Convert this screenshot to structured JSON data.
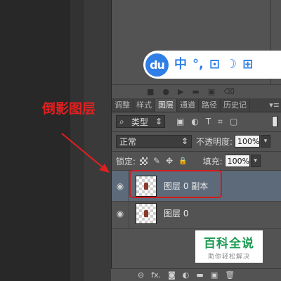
{
  "ime": {
    "logo": "du",
    "items": [
      {
        "icon": "chinese-mode-icon",
        "text": "中"
      },
      {
        "icon": "punctuation-icon",
        "text": "°,"
      },
      {
        "icon": "keyboard-icon",
        "text": "⊡"
      },
      {
        "icon": "skin-moon-icon",
        "text": "☽"
      },
      {
        "icon": "grid-menu-icon",
        "text": "⊞"
      }
    ]
  },
  "mini_bar": {
    "icons": [
      "■",
      "●",
      "▶",
      "▬",
      "▣",
      "⌫"
    ]
  },
  "tabs": [
    {
      "label": "调整",
      "active": false
    },
    {
      "label": "样式",
      "active": false
    },
    {
      "label": "图层",
      "active": true
    },
    {
      "label": "通道",
      "active": false
    },
    {
      "label": "路径",
      "active": false
    },
    {
      "label": "历史记",
      "active": false
    }
  ],
  "tab_menu": "▾≡",
  "filter": {
    "search_icon": "⌕",
    "label": "类型",
    "arrow": "⇕",
    "icons": [
      {
        "name": "pixel-filter-icon",
        "glyph": "▣"
      },
      {
        "name": "adjustment-filter-icon",
        "glyph": "◐"
      },
      {
        "name": "type-filter-icon",
        "glyph": "T"
      },
      {
        "name": "shape-filter-icon",
        "glyph": "⌗"
      },
      {
        "name": "smart-object-filter-icon",
        "glyph": "▢"
      }
    ]
  },
  "blend": {
    "mode": "正常",
    "arrow": "⇕",
    "opacity_label": "不透明度:",
    "opacity_value": "100%",
    "dropdown_arrow": "▾"
  },
  "lock": {
    "label": "锁定:",
    "icons": [
      {
        "name": "brush-icon",
        "glyph": "✎"
      },
      {
        "name": "move-icon",
        "glyph": "✥"
      },
      {
        "name": "lock-icon",
        "glyph": "🔒"
      }
    ],
    "fill_label": "填充:",
    "fill_value": "100%",
    "dropdown_arrow": "▾"
  },
  "layers": [
    {
      "name": "图层 0 副本",
      "selected": true,
      "eye": "◉"
    },
    {
      "name": "图层 0",
      "selected": false,
      "eye": "◉"
    }
  ],
  "annotation": {
    "text": "倒影图层",
    "color": "#e02020"
  },
  "watermark": {
    "title": "百科全说",
    "subtitle": "助你轻松解决"
  },
  "bottom_bar": {
    "icons": [
      "⊖",
      "fx.",
      "◙",
      "◐",
      "▬",
      "▣",
      "🗑"
    ]
  },
  "colors": {
    "panel_bg": "#535353",
    "selected_layer": "#5d6a7a",
    "highlight_red": "#d21b1b",
    "ime_blue": "#2f7fe6",
    "watermark_green": "#1b9a52"
  }
}
